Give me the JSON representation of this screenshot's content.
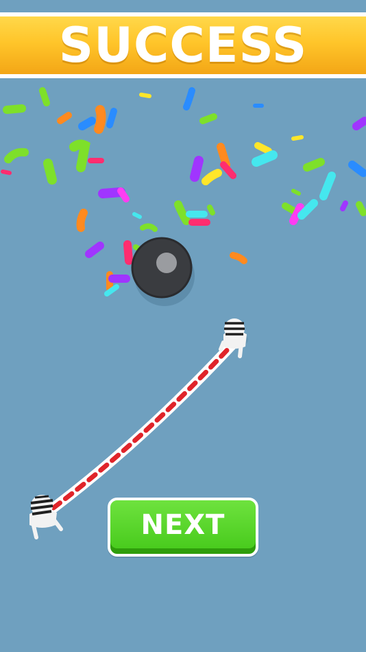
{
  "banner": {
    "text": "SUCCESS",
    "colors": {
      "top": "#ffd84a",
      "bottom": "#f3a616",
      "border": "#ffffff"
    }
  },
  "next_button": {
    "label": "NEXT",
    "colors": {
      "fill": "#45c91a",
      "shade": "#2f9d0b",
      "border": "#ffffff"
    }
  },
  "scene": {
    "background": "#6fa0bf",
    "confetti_colors": [
      "#7ee02a",
      "#ff8a1f",
      "#2a8cff",
      "#a035ff",
      "#ff2d6f",
      "#45e7ee",
      "#ffe62a",
      "#ff3df2"
    ]
  },
  "icons": [
    "confetti",
    "wrecking-ball-icon",
    "prisoner-icon",
    "chain"
  ]
}
